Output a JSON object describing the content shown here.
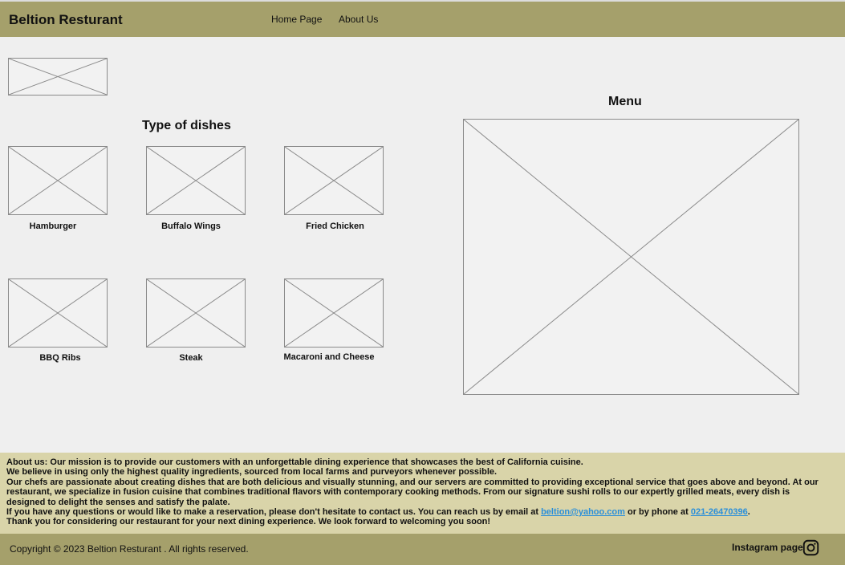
{
  "header": {
    "brand": "Beltion Resturant",
    "nav": [
      "Home Page",
      "About Us"
    ]
  },
  "dishes": {
    "title": "Type of dishes",
    "items": [
      "Hamburger",
      "Buffalo Wings",
      "Fried Chicken",
      "BBQ Ribs",
      "Steak",
      "Macaroni and Cheese"
    ]
  },
  "menu": {
    "title": "Menu"
  },
  "about": {
    "label": "About us:",
    "line1": " Our mission is to provide our customers with an unforgettable dining experience that showcases the best of California cuisine.",
    "line2": "We believe in using only the highest quality ingredients, sourced from local farms and purveyors whenever possible.",
    "line3": "Our chefs are passionate about creating dishes that are both delicious and visually stunning, and our servers are committed to providing exceptional service that goes above and beyond. At our restaurant, we specialize in fusion cuisine that combines traditional flavors with contemporary cooking methods. From our signature sushi rolls to our expertly grilled meats, every dish is designed to delight the senses and satisfy the palate.",
    "contact_pre": "If you have any questions or would like to make a reservation, please don't hesitate to contact us. You can reach us by email at ",
    "email": "beltion@yahoo.com",
    "contact_mid": " or by phone at ",
    "phone": "021-26470396",
    "contact_post": ".",
    "line5": "Thank you for considering our restaurant for your next dining experience. We look forward to welcoming you soon!"
  },
  "footer": {
    "copyright": "Copyright © 2023 Beltion Resturant . All rights reserved.",
    "instagram_label": "Instagram page",
    "instagram_icon": "instagram-icon"
  }
}
